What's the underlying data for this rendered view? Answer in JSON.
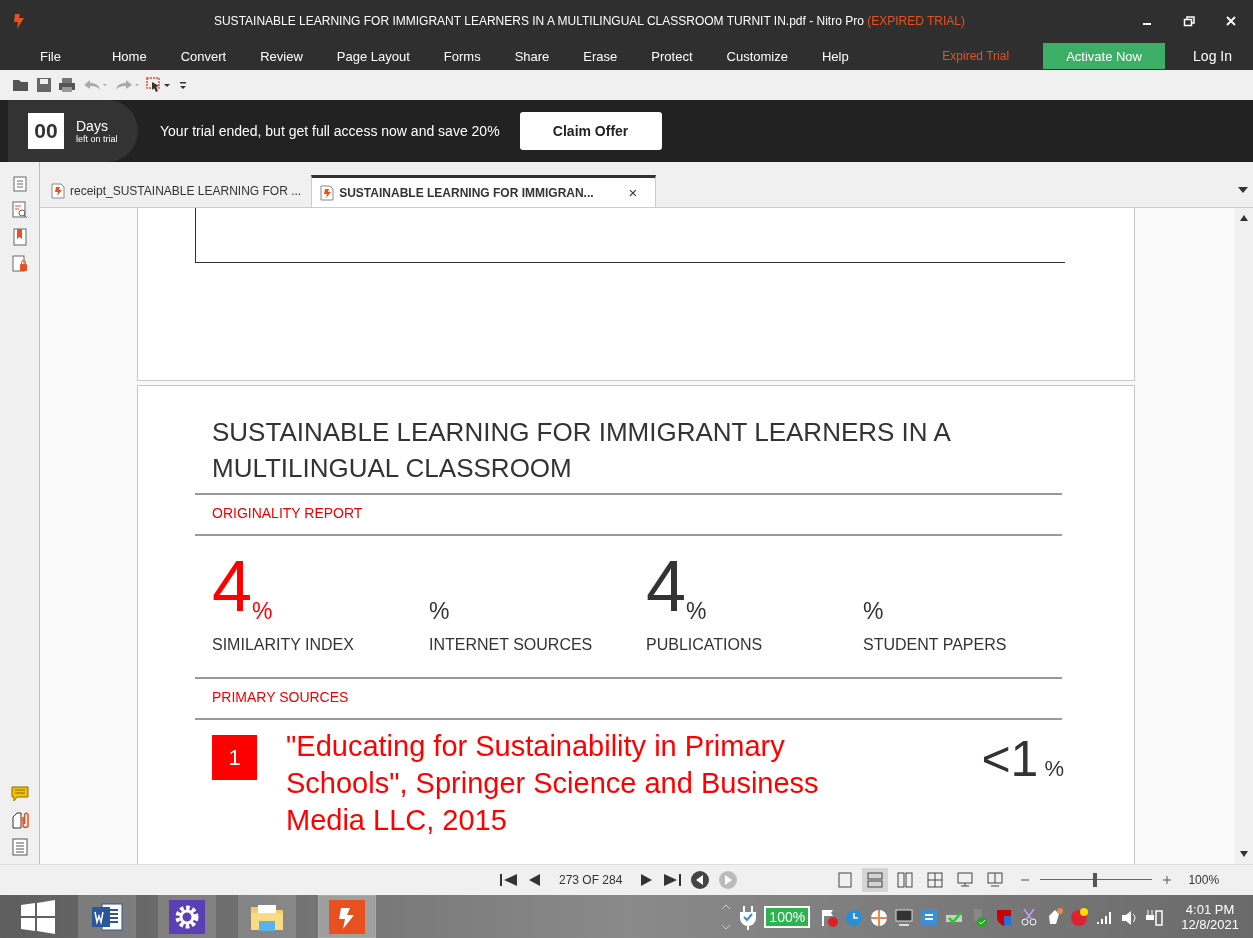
{
  "window": {
    "title": "SUSTAINABLE LEARNING FOR IMMIGRANT LEARNERS IN A MULTILINGUAL CLASSROOM TURNIT IN.pdf - Nitro Pro",
    "title_note": "(EXPIRED TRIAL)"
  },
  "menu": {
    "items": [
      "File",
      "Home",
      "Convert",
      "Review",
      "Page Layout",
      "Forms",
      "Share",
      "Erase",
      "Protect",
      "Customize",
      "Help"
    ],
    "trial_label": "Expired Trial",
    "activate_button": "Activate Now",
    "login": "Log In"
  },
  "trial_banner": {
    "days_count": "00",
    "days_label": "Days",
    "days_sublabel": "left on trial",
    "message": "Your trial ended, but get full access now and save 20%",
    "button": "Claim Offer"
  },
  "tabs": [
    {
      "label": "receipt_SUSTAINABLE LEARNING FOR ...",
      "selected": false
    },
    {
      "label": "SUSTAINABLE LEARNING FOR IMMIGRAN...",
      "selected": true,
      "close": "×"
    }
  ],
  "document": {
    "title": "SUSTAINABLE LEARNING FOR IMMIGRANT LEARNERS IN A MULTILINGUAL CLASSROOM",
    "report_heading": "ORIGINALITY REPORT",
    "stats": [
      {
        "value": "4",
        "unit": "%",
        "label": "SIMILARITY INDEX",
        "color": "#ff0000"
      },
      {
        "unit": "%",
        "label": "INTERNET SOURCES"
      },
      {
        "value": "4",
        "unit": "%",
        "label": "PUBLICATIONS",
        "color": "#333333"
      },
      {
        "unit": "%",
        "label": "STUDENT PAPERS"
      }
    ],
    "sources_heading": "PRIMARY SOURCES",
    "sources": [
      {
        "number": "1",
        "text": "\"Educating for Sustainability in Primary Schools\", Springer Science and Business Media LLC, 2015",
        "share": "<1",
        "unit": "%"
      }
    ]
  },
  "navigation": {
    "page": "273 OF 284",
    "view_modes": [
      {
        "selected": false
      },
      {
        "selected": true
      },
      {
        "selected": false
      },
      {
        "selected": false
      },
      {
        "selected": false
      },
      {
        "selected": false
      }
    ],
    "zoom_slider": {
      "level": 0.49
    },
    "zoom": "100%"
  },
  "taskbar": {
    "battery": "100%",
    "time": "4:01 PM",
    "date": "12/8/2021"
  }
}
